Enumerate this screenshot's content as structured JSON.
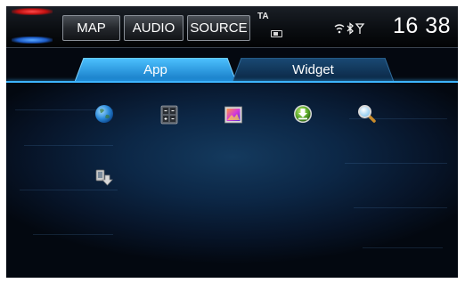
{
  "header": {
    "buttons": [
      "MAP",
      "AUDIO",
      "SOURCE"
    ],
    "ta": "TA",
    "status_icons": "≈ ✱ ᴛ",
    "clock": "16 38"
  },
  "tabs": [
    {
      "label": "App",
      "active": true
    },
    {
      "label": "Widget",
      "active": false
    }
  ],
  "apps": [
    {
      "icon": "globe-icon"
    },
    {
      "icon": "calculator-icon"
    },
    {
      "icon": "picture-icon"
    },
    {
      "icon": "download-icon"
    },
    {
      "icon": "magnifier-icon"
    },
    {
      "icon": "app-install-icon"
    }
  ],
  "colors": {
    "accent": "#3db4ff",
    "active_tab": "#1e8fd8",
    "inactive_tab": "#0f2f4f"
  }
}
